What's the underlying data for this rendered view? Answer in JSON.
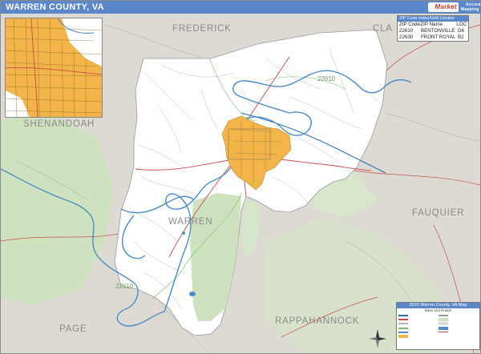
{
  "title": "WARREN COUNTY, VA",
  "brand": {
    "logo_text": "Market",
    "tagline": "Accurate Mapping"
  },
  "counties": {
    "frederick": "FREDERICK",
    "clarke": "CLA",
    "shenandoah": "SHENANDOAH",
    "warren": "WARREN",
    "fauquier": "FAUQUIER",
    "page": "PAGE",
    "rappahannock": "RAPPAHANNOCK"
  },
  "zip_labels": {
    "north": "22610",
    "south": "22610"
  },
  "zip_table": {
    "caption": "ZIP Code Index/Grid Locator",
    "headers": [
      "ZIP Code",
      "ZIP Name",
      "LOC"
    ],
    "rows": [
      [
        "22610",
        "BENTONVILLE",
        "D6"
      ],
      [
        "22630",
        "FRONT ROYAL",
        "B2"
      ]
    ]
  },
  "legend": {
    "title": "2016 Warren County, VA Map",
    "subtitle": "Base and Roads"
  },
  "colors": {
    "title_bar": "#5a87c9",
    "county_fill": "#ffffff",
    "surround": "#dcdad2",
    "forest": "#cfe2bf",
    "water": "#4b8bc6",
    "city": "#f3b54a"
  }
}
